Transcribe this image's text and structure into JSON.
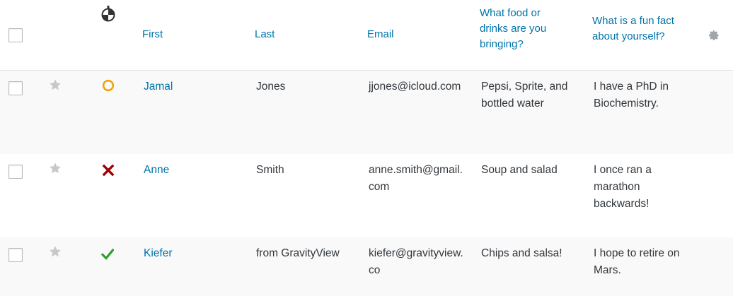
{
  "header": {
    "columns": {
      "first": "First",
      "last": "Last",
      "email": "Email",
      "food": "What food or drinks are you bringing?",
      "fun_fact": "What is a fun fact about yourself?"
    }
  },
  "rows": [
    {
      "starred": false,
      "status": "pending",
      "first": "Jamal",
      "last": "Jones",
      "email": "jjones@icloud.com",
      "food": "Pepsi, Sprite, and bottled water",
      "fun_fact": "I have a PhD in Biochemistry."
    },
    {
      "starred": false,
      "status": "rejected",
      "first": "Anne",
      "last": "Smith",
      "email": "anne.smith@gmail.com",
      "food": "Soup and salad",
      "fun_fact": "I once ran a marathon backwards!"
    },
    {
      "starred": false,
      "status": "approved",
      "first": "Kiefer",
      "last": "from GravityView",
      "email": "kiefer@gravityview.co",
      "food": "Chips and salsa!",
      "fun_fact": "I hope to retire on Mars."
    }
  ],
  "colors": {
    "link": "#0073aa",
    "text": "#32373c",
    "pending": "#f0a30a",
    "rejected": "#a00000",
    "approved": "#2ea02e",
    "star": "#c8c8c8",
    "row_alt": "#f9f9f9"
  },
  "icons": {
    "approval_column": "approval-status-icon",
    "settings": "gear-icon",
    "star": "star-icon",
    "pending": "circle-outline-icon",
    "rejected": "x-mark-icon",
    "approved": "checkmark-icon"
  }
}
